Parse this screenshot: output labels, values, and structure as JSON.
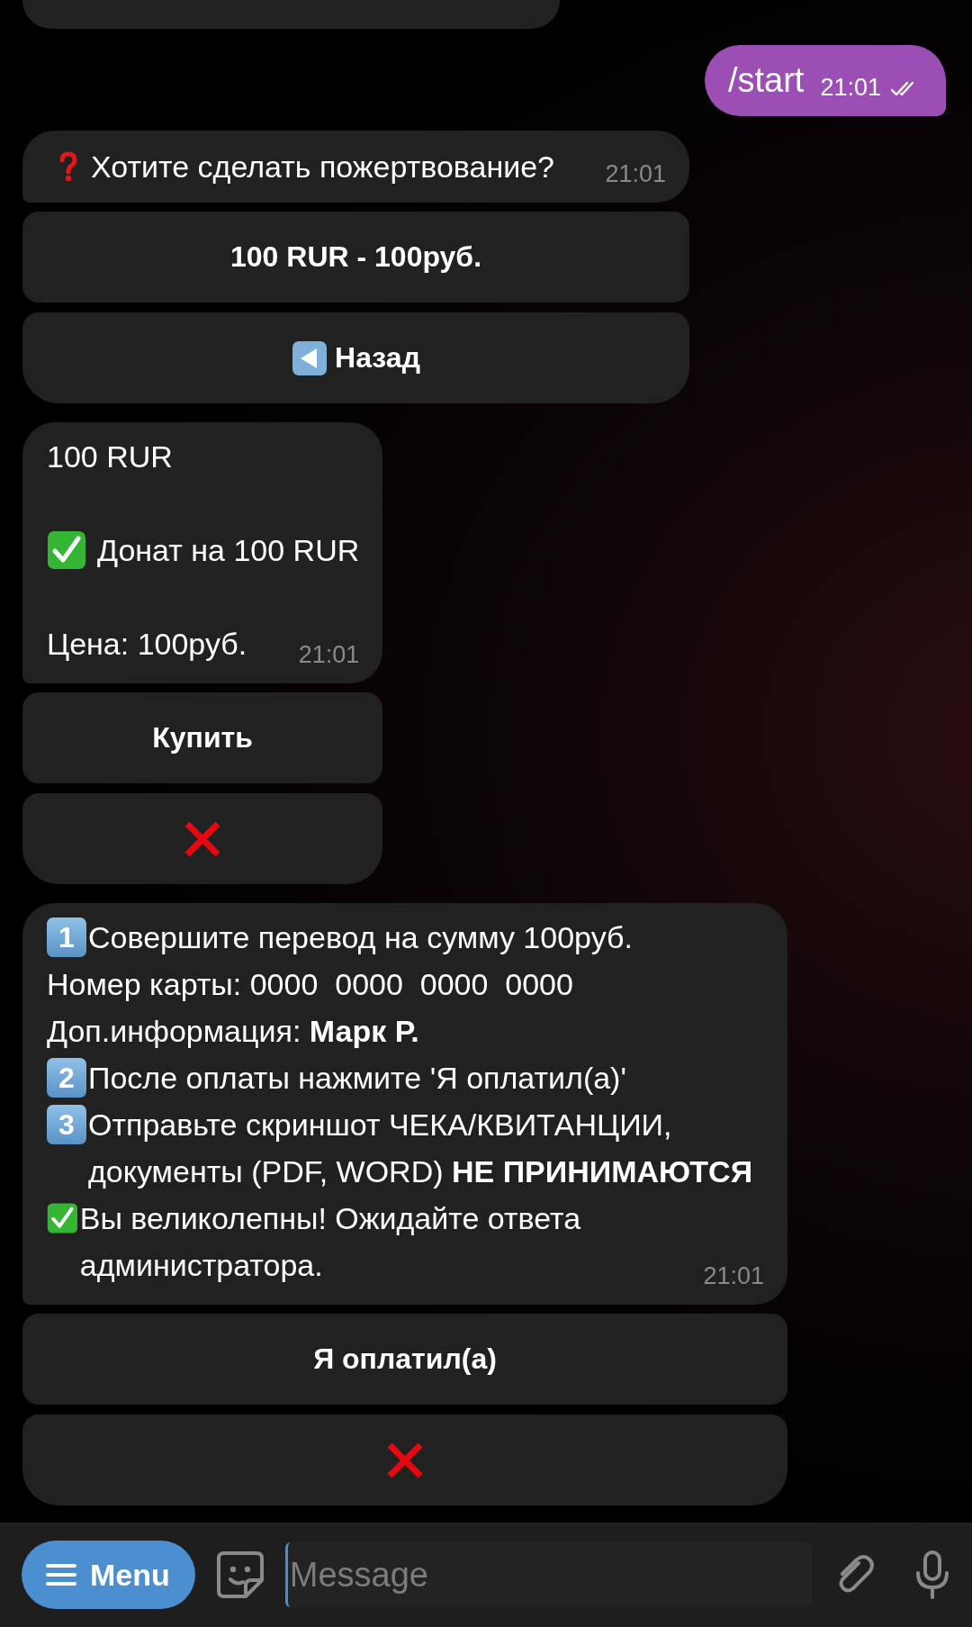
{
  "messages": [
    {
      "kind": "cut"
    },
    {
      "kind": "outgoing",
      "text": "/start",
      "time": "21:01",
      "read": true
    },
    {
      "kind": "incoming",
      "time": "21:01",
      "lines": [
        {
          "kind": "question",
          "text": "Хотите сделать пожертвование?"
        }
      ],
      "keyboard": [
        {
          "kind": "text",
          "label": "100 RUR - 100руб."
        },
        {
          "kind": "back",
          "label": "Назад"
        }
      ]
    },
    {
      "kind": "incoming",
      "spaced": true,
      "time": "21:01",
      "lines": [
        {
          "kind": "plain",
          "text": "100 RUR"
        },
        {
          "kind": "check",
          "text": "Донат на 100 RUR"
        },
        {
          "kind": "plain",
          "text": "Цена: 100руб."
        }
      ],
      "keyboard": [
        {
          "kind": "text",
          "label": "Купить"
        },
        {
          "kind": "cancel"
        }
      ]
    },
    {
      "kind": "incoming",
      "spaced": false,
      "time": "21:01",
      "lines": [
        {
          "kind": "keycap",
          "key": "1",
          "text": "Совершите перевод на сумму 100руб."
        },
        {
          "kind": "plain",
          "text": "Номер карты: 0000  0000  0000  0000"
        },
        {
          "kind": "plain",
          "text": "Доп.информация: **Марк Р.**"
        },
        {
          "kind": "keycap",
          "key": "2",
          "text": "После оплаты нажмите 'Я оплатил(а)'"
        },
        {
          "kind": "keycap",
          "key": "3",
          "text": "Отправьте скриншот ЧЕКА/КВИТАНЦИИ, документы (PDF, WORD) **НЕ ПРИНИМАЮТСЯ**"
        },
        {
          "kind": "check",
          "text": "Вы великолепны! Ожидайте ответа администратора."
        }
      ],
      "keyboard": [
        {
          "kind": "text",
          "label": "Я оплатил(а)"
        },
        {
          "kind": "cancel"
        }
      ]
    }
  ],
  "composer": {
    "menu": "Menu",
    "placeholder": "Message"
  }
}
